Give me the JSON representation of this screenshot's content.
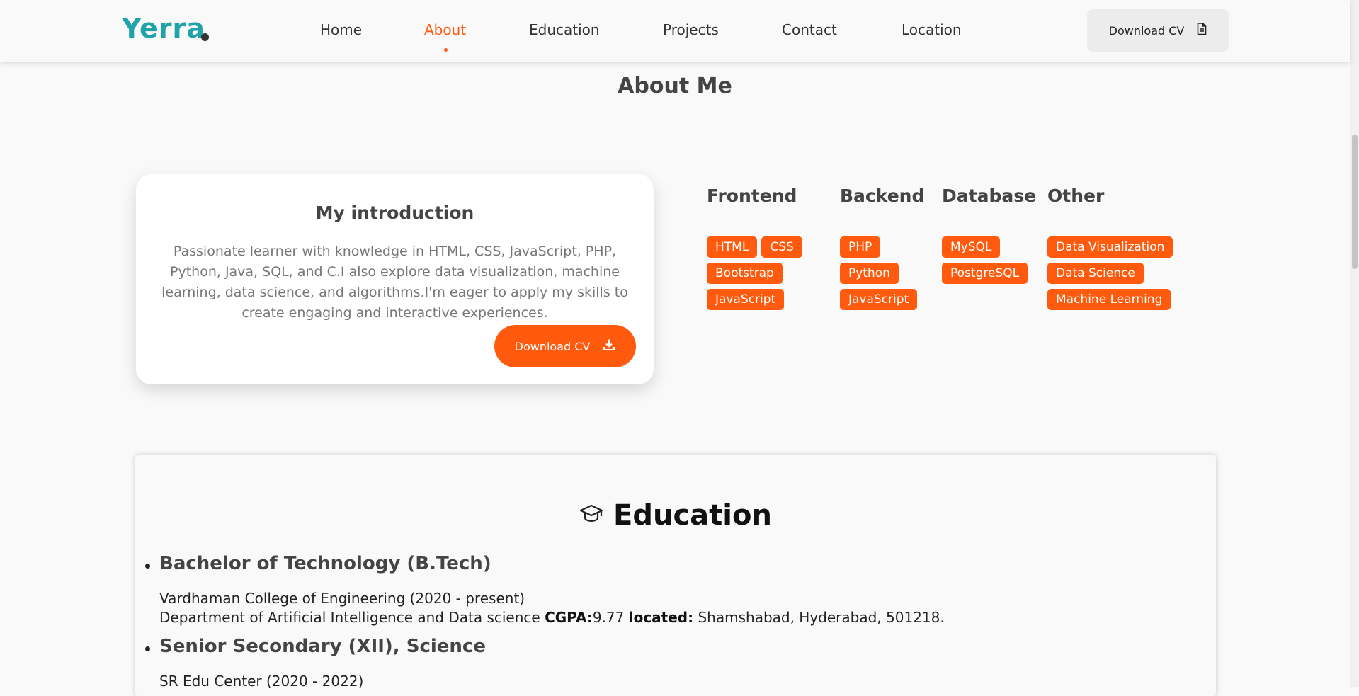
{
  "header": {
    "logo": "Yerra",
    "nav": [
      "Home",
      "About",
      "Education",
      "Projects",
      "Contact",
      "Location"
    ],
    "active_nav": "About",
    "download_cv": "Download CV"
  },
  "about": {
    "title": "About Me",
    "intro_title": "My introduction",
    "intro_text": "Passionate learner with knowledge in HTML, CSS, JavaScript, PHP, Python, Java, SQL, and C.I also explore data visualization, machine learning, data science, and algorithms.I'm eager to apply my skills to create engaging and interactive experiences.",
    "download_cv": "Download CV"
  },
  "skills": [
    {
      "title": "Frontend",
      "tags": [
        "HTML",
        "CSS",
        "Bootstrap",
        "JavaScript"
      ]
    },
    {
      "title": "Backend",
      "tags": [
        "PHP",
        "Python",
        "JavaScript"
      ]
    },
    {
      "title": "Database",
      "tags": [
        "MySQL",
        "PostgreSQL"
      ]
    },
    {
      "title": "Other",
      "tags": [
        "Data Visualization",
        "Data Science",
        "Machine Learning"
      ]
    }
  ],
  "education": {
    "title": "Education",
    "items": [
      {
        "title": "Bachelor of Technology (B.Tech)",
        "institution": "Vardhaman College of Engineering (2020 - present)",
        "department": "Department of Artificial Intelligence and Data science",
        "cgpa_label": "CGPA:",
        "cgpa": "9.77",
        "located_label": "located:",
        "location": "Shamshabad, Hyderabad, 501218."
      },
      {
        "title": "Senior Secondary (XII), Science",
        "institution": "SR Edu Center (2020 - 2022)"
      }
    ]
  },
  "colors": {
    "accent": "#ff5a0d",
    "logo": "#1fa2a8"
  },
  "icons": {
    "header_cv": "document-icon",
    "intro_cv": "download-icon",
    "education": "graduation-cap-icon"
  }
}
